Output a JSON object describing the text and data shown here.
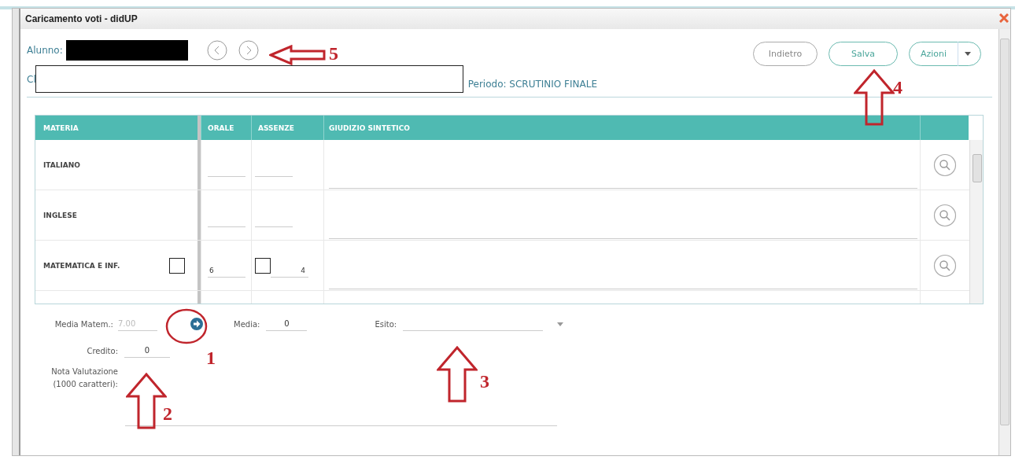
{
  "window": {
    "title": "Caricamento voti - didUP"
  },
  "header": {
    "student_label": "Alunno:",
    "class_label": "Cl",
    "period": "Periodo: SCRUTINIO FINALE"
  },
  "buttons": [
    {
      "label": "Indietro",
      "kind": "plain"
    },
    {
      "label": "Salva",
      "kind": "primary"
    },
    {
      "label": "Azioni",
      "kind": "dropdown"
    }
  ],
  "table": {
    "columns": [
      "MATERIA",
      "ORALE",
      "ASSENZE",
      "GIUDIZIO SINTETICO"
    ],
    "rows": [
      {
        "subject": "ITALIANO"
      },
      {
        "subject": "INGLESE"
      },
      {
        "subject": "MATEMATICA E INF.",
        "orale": "6",
        "assenze": "4",
        "checkboxes": [
          {
            "checked": false
          },
          {
            "checked": false
          }
        ]
      }
    ]
  },
  "summary": {
    "media_matem": {
      "label": "Media Matem.:",
      "value": "7.00",
      "disabled": true
    },
    "media": {
      "label": "Media:",
      "value": "0"
    },
    "esito": {
      "label": "Esito:"
    },
    "credito": {
      "label": "Credito:",
      "value": "0"
    },
    "nota": {
      "label": "Nota Valutazione (1000 caratteri):"
    }
  },
  "annotations": [
    {
      "number": "1",
      "kind": "circle"
    },
    {
      "number": "2",
      "kind": "arrow-up"
    },
    {
      "number": "3",
      "kind": "arrow-up"
    },
    {
      "number": "4",
      "kind": "arrow-up"
    },
    {
      "number": "5",
      "kind": "arrow-left"
    }
  ]
}
